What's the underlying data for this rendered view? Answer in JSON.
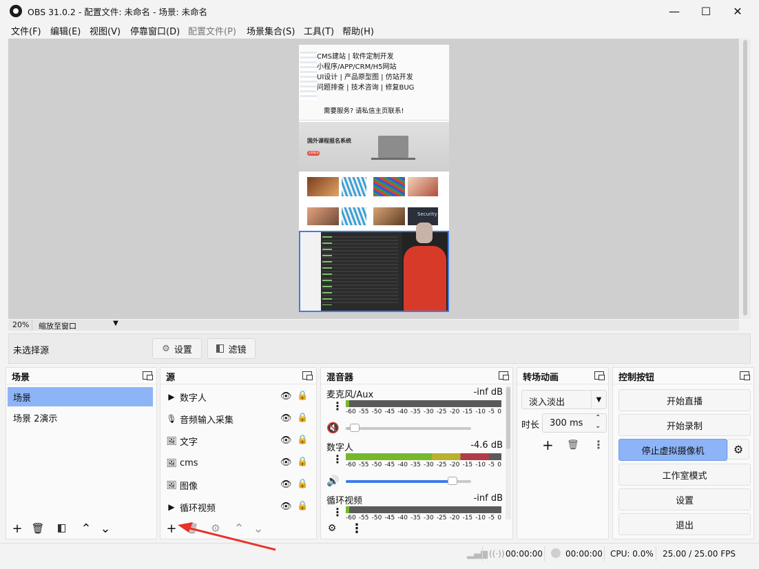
{
  "window": {
    "title": "OBS 31.0.2 - 配置文件: 未命名 - 场景: 未命名",
    "minimize": "—",
    "maximize": "☐",
    "close": "✕"
  },
  "menu": [
    {
      "label": "文件(F)"
    },
    {
      "label": "编辑(E)"
    },
    {
      "label": "视图(V)"
    },
    {
      "label": "停靠窗口(D)"
    },
    {
      "label": "配置文件(P)"
    },
    {
      "label": "场景集合(S)"
    },
    {
      "label": "工具(T)"
    },
    {
      "label": "帮助(H)"
    }
  ],
  "preview": {
    "overlay_lines": [
      "CMS建站 | 软件定制开发",
      "小程序/APP/CRM/H5网站",
      "UI设计 | 产品原型图 | 仿站开发",
      "问题排查 | 技术咨询 | 修复BUG"
    ],
    "overlay_bottom": "需要服务? 请私信主页联系!",
    "banner_text": "国外课程报名系统",
    "banner_button": "立即报名",
    "security_tag": "Security",
    "zoom": "20%",
    "zoom_mode": "缩放至窗口"
  },
  "toolbar": {
    "no_source": "未选择源",
    "settings": "设置",
    "filters": "滤镜"
  },
  "scenes": {
    "title": "场景",
    "items": [
      {
        "label": "场景",
        "selected": true
      },
      {
        "label": "场景 2演示",
        "selected": false
      }
    ]
  },
  "sources": {
    "title": "源",
    "items": [
      {
        "icon": "play-icon",
        "label": "数字人"
      },
      {
        "icon": "microphone-icon",
        "label": "音频输入采集"
      },
      {
        "icon": "image-icon",
        "label": "文字"
      },
      {
        "icon": "image-icon",
        "label": "cms"
      },
      {
        "icon": "image-icon",
        "label": "图像"
      },
      {
        "icon": "play-icon",
        "label": "循环视频"
      }
    ]
  },
  "mixer": {
    "title": "混音器",
    "tick_labels": [
      "-60",
      "-55",
      "-50",
      "-45",
      "-40",
      "-35",
      "-30",
      "-25",
      "-20",
      "-15",
      "-10",
      "-5",
      "0"
    ],
    "channels": [
      {
        "name": "麦克风/Aux",
        "db": "-inf dB",
        "muted": true,
        "level": 0.02,
        "volume": 0.07
      },
      {
        "name": "数字人",
        "db": "-4.6 dB",
        "muted": false,
        "level": 0.92,
        "volume": 0.85
      },
      {
        "name": "循环视频",
        "db": "-inf dB",
        "muted": false,
        "level": 0.02,
        "volume": 0.85
      }
    ]
  },
  "transitions": {
    "title": "转场动画",
    "type": "淡入淡出",
    "duration_label": "时长",
    "duration_value": "300 ms"
  },
  "controls": {
    "title": "控制按钮",
    "start_stream": "开始直播",
    "start_record": "开始录制",
    "stop_virtual_cam": "停止虚拟摄像机",
    "studio_mode": "工作室模式",
    "settings": "设置",
    "exit": "退出"
  },
  "status": {
    "stream_time": "00:00:00",
    "record_time": "00:00:00",
    "cpu": "CPU: 0.0%",
    "fps": "25.00 / 25.00 FPS"
  },
  "colors": {
    "accent": "#8db4f7",
    "annotation_arrow": "#e8322a",
    "meter_green": "#76b82a",
    "volume_blue": "#3d7ce6"
  }
}
